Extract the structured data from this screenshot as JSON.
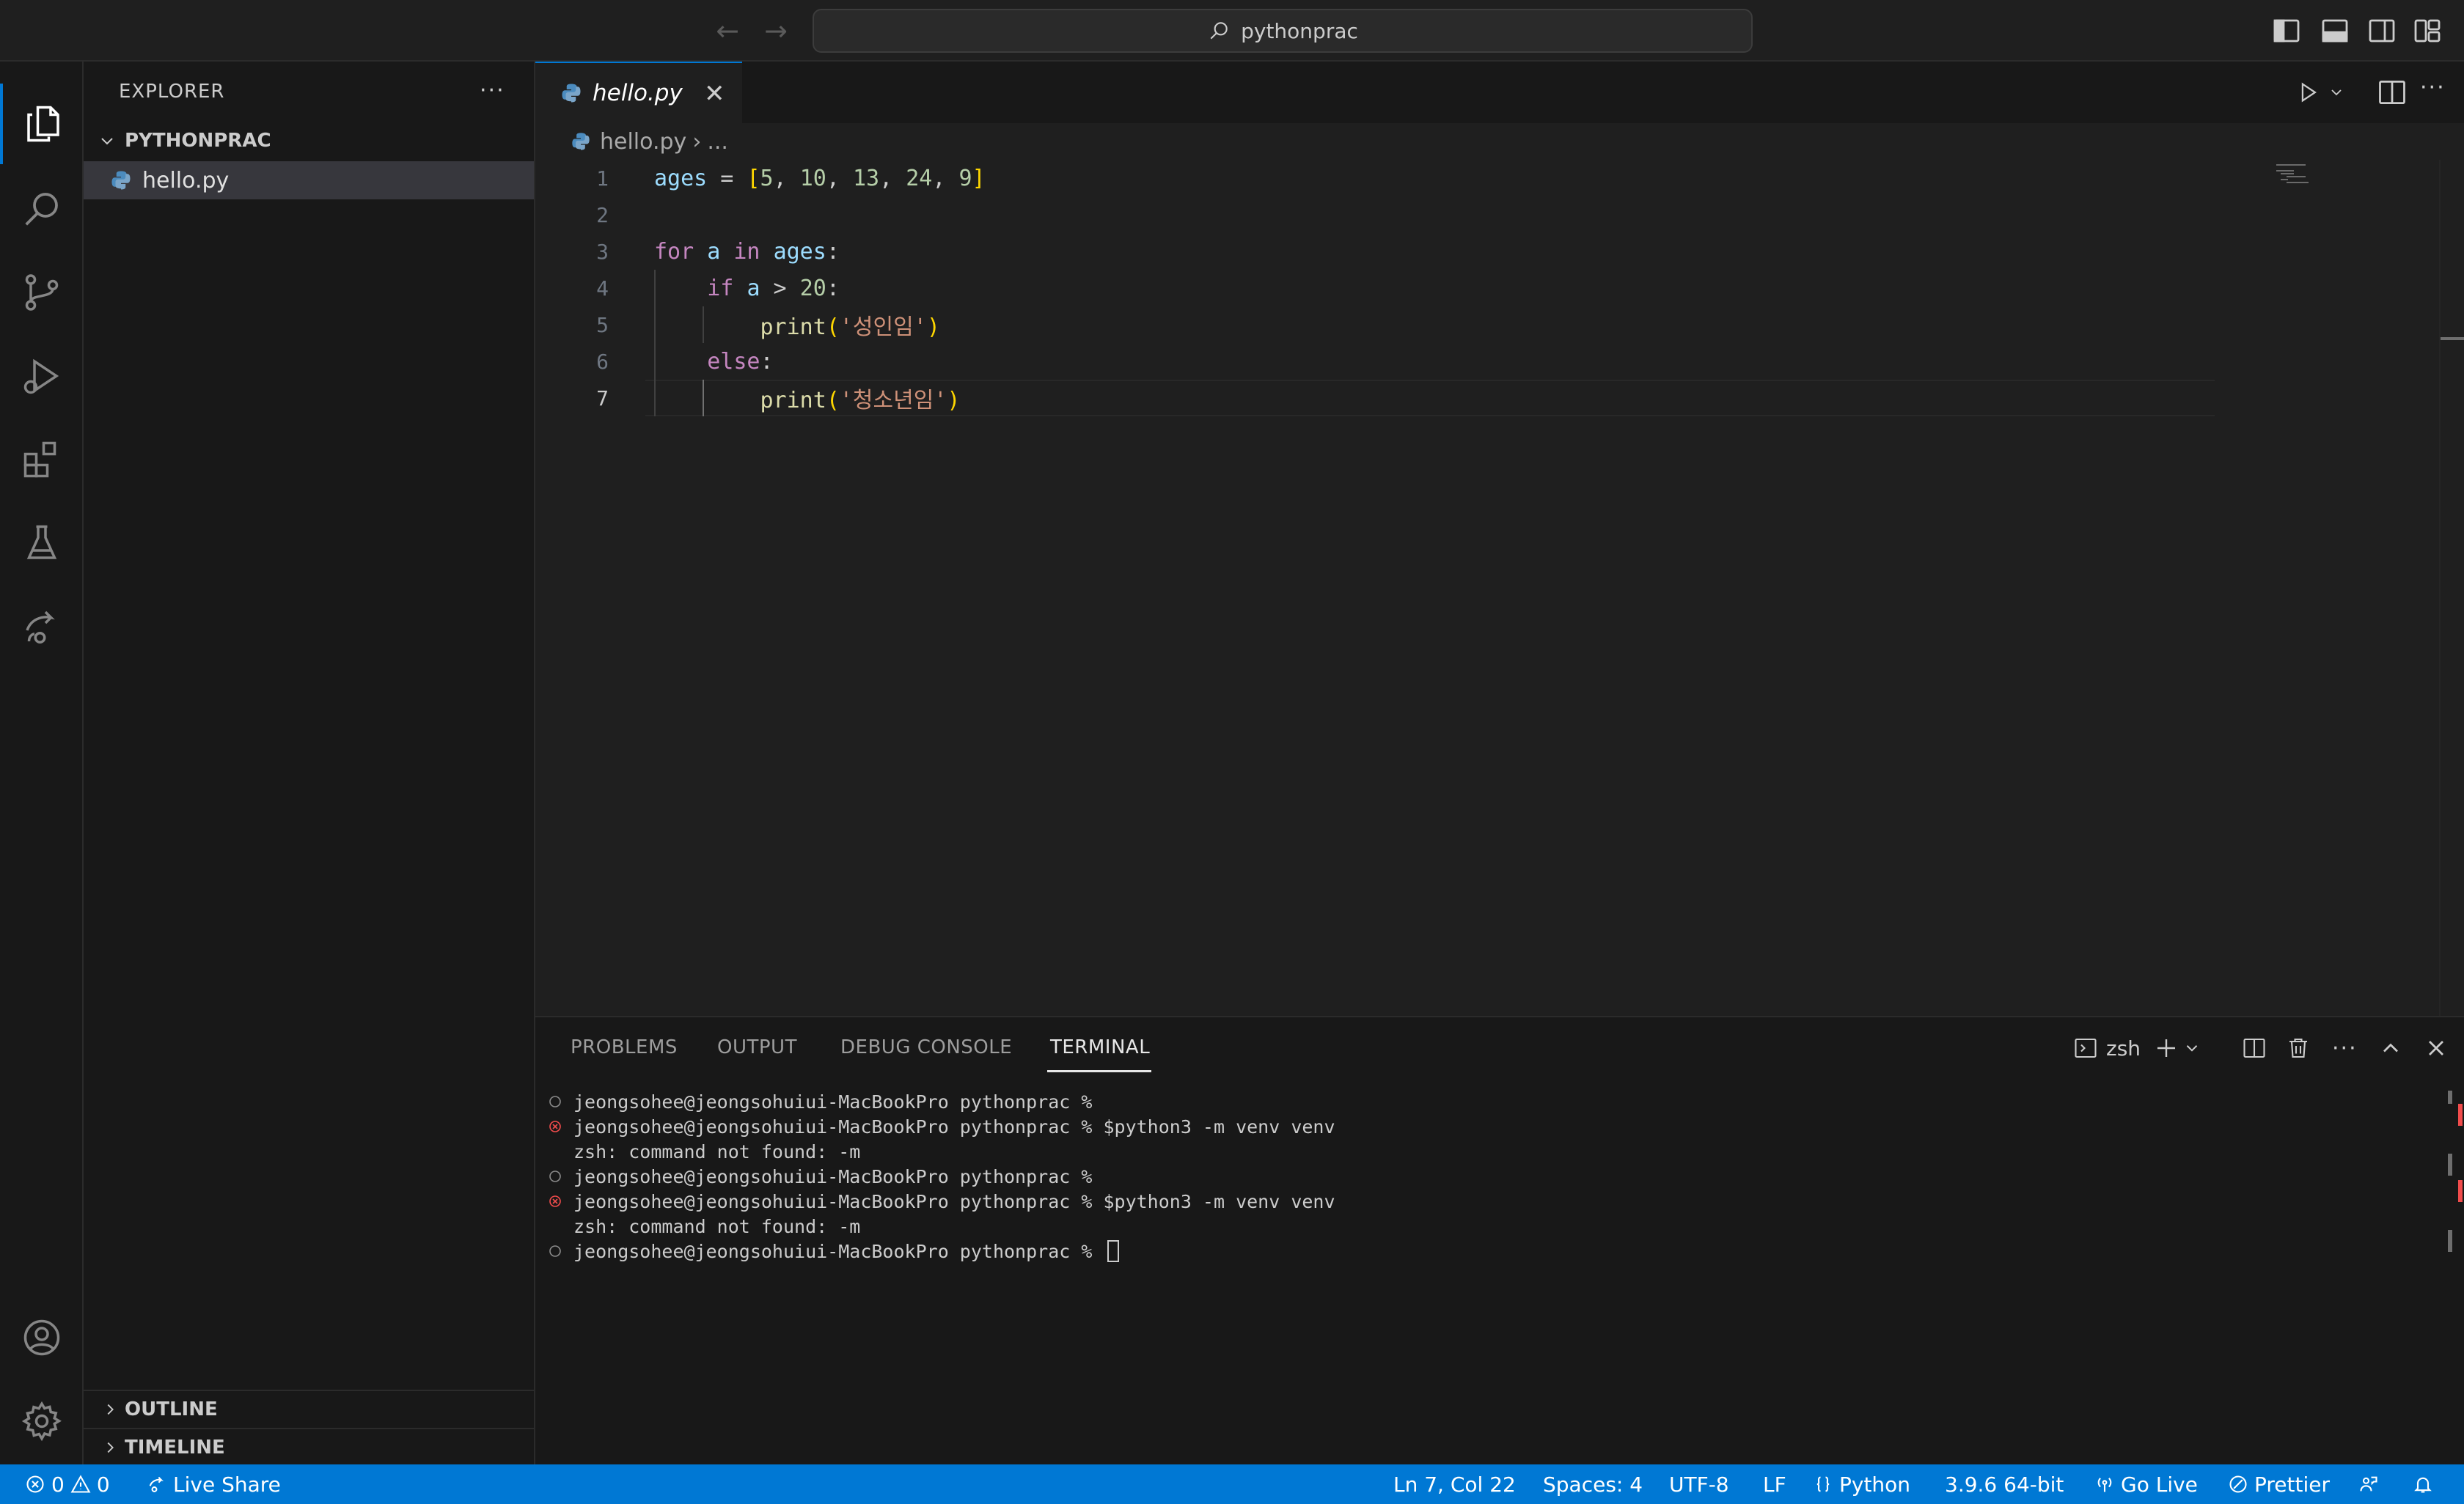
{
  "titlebar": {
    "search_text": "pythonprac"
  },
  "sidebar": {
    "title": "EXPLORER",
    "more_label": "···",
    "folder_name": "PYTHONPRAC",
    "files": [
      "hello.py"
    ],
    "outline_label": "OUTLINE",
    "timeline_label": "TIMELINE"
  },
  "editor": {
    "tab_label": "hello.py",
    "close_label": "✕",
    "more_label": "···",
    "breadcrumb": {
      "file": "hello.py",
      "sep": "›",
      "rest": "..."
    },
    "line_numbers": [
      "1",
      "2",
      "3",
      "4",
      "5",
      "6",
      "7"
    ],
    "current_line": 7
  },
  "panel": {
    "tabs": [
      "PROBLEMS",
      "OUTPUT",
      "DEBUG CONSOLE",
      "TERMINAL"
    ],
    "active_tab": "TERMINAL",
    "shell_label": "zsh",
    "more_label": "···",
    "terminal_lines": [
      {
        "status": "ok",
        "text": "jeongsohee@jeongsohuiui-MacBookPro pythonprac % "
      },
      {
        "status": "error",
        "text": "jeongsohee@jeongsohuiui-MacBookPro pythonprac % $python3 -m venv venv"
      },
      {
        "status": "none",
        "text": "zsh: command not found: -m"
      },
      {
        "status": "ok",
        "text": "jeongsohee@jeongsohuiui-MacBookPro pythonprac % "
      },
      {
        "status": "error",
        "text": "jeongsohee@jeongsohuiui-MacBookPro pythonprac % $python3 -m venv venv"
      },
      {
        "status": "none",
        "text": "zsh: command not found: -m"
      },
      {
        "status": "ok",
        "text": "jeongsohee@jeongsohuiui-MacBookPro pythonprac % "
      }
    ]
  },
  "statusbar": {
    "errors": "0",
    "warnings": "0",
    "live_share": "Live Share",
    "position": "Ln 7, Col 22",
    "spaces": "Spaces: 4",
    "encoding": "UTF-8",
    "eol": "LF",
    "language": "Python",
    "interpreter": "3.9.6 64-bit",
    "go_live": "Go Live",
    "prettier": "Prettier"
  },
  "colors": {
    "accent": "#0078d4",
    "error": "#f14c4c",
    "keyword": "#569cd6",
    "control_keyword": "#c586c0",
    "string": "#ce9178",
    "number": "#b5cea8",
    "bracket": "#ffd700"
  }
}
